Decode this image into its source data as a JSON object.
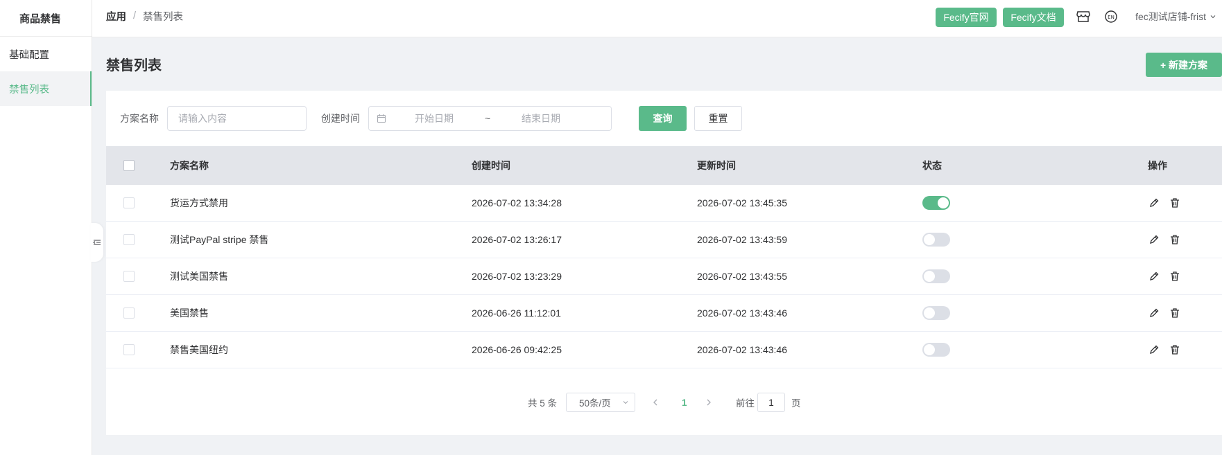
{
  "sidebar": {
    "title": "商品禁售",
    "items": [
      {
        "label": "基础配置"
      },
      {
        "label": "禁售列表"
      }
    ]
  },
  "header": {
    "breadcrumb": {
      "first": "应用",
      "separator": "/",
      "current": "禁售列表"
    },
    "btn_site": "Fecify官网",
    "btn_docs": "Fecify文档",
    "user": "fec测试店铺-frist",
    "lang_icon_text": "EN"
  },
  "page": {
    "title": "禁售列表",
    "new_button": "+ 新建方案"
  },
  "filters": {
    "name_label": "方案名称",
    "name_placeholder": "请输入内容",
    "time_label": "创建时间",
    "start_placeholder": "开始日期",
    "range_sep": "~",
    "end_placeholder": "结束日期",
    "query_btn": "查询",
    "reset_btn": "重置"
  },
  "table": {
    "headers": {
      "name": "方案名称",
      "created": "创建时间",
      "updated": "更新时间",
      "status": "状态",
      "ops": "操作"
    },
    "rows": [
      {
        "name": "货运方式禁用",
        "created": "2026-07-02 13:34:28",
        "updated": "2026-07-02 13:45:35",
        "enabled": true
      },
      {
        "name": "测试PayPal stripe 禁售",
        "created": "2026-07-02 13:26:17",
        "updated": "2026-07-02 13:43:59",
        "enabled": false
      },
      {
        "name": "测试美国禁售",
        "created": "2026-07-02 13:23:29",
        "updated": "2026-07-02 13:43:55",
        "enabled": false
      },
      {
        "name": "美国禁售",
        "created": "2026-06-26 11:12:01",
        "updated": "2026-07-02 13:43:46",
        "enabled": false
      },
      {
        "name": "禁售美国纽约",
        "created": "2026-06-26 09:42:25",
        "updated": "2026-07-02 13:43:46",
        "enabled": false
      }
    ]
  },
  "pagination": {
    "total": "共 5 条",
    "page_size": "50条/页",
    "current_page": "1",
    "goto_label": "前往",
    "goto_value": "1",
    "page_unit": "页"
  },
  "colors": {
    "accent": "#5aba8a",
    "arrow": "#e8433a",
    "header_bg": "#e3e5ea"
  }
}
